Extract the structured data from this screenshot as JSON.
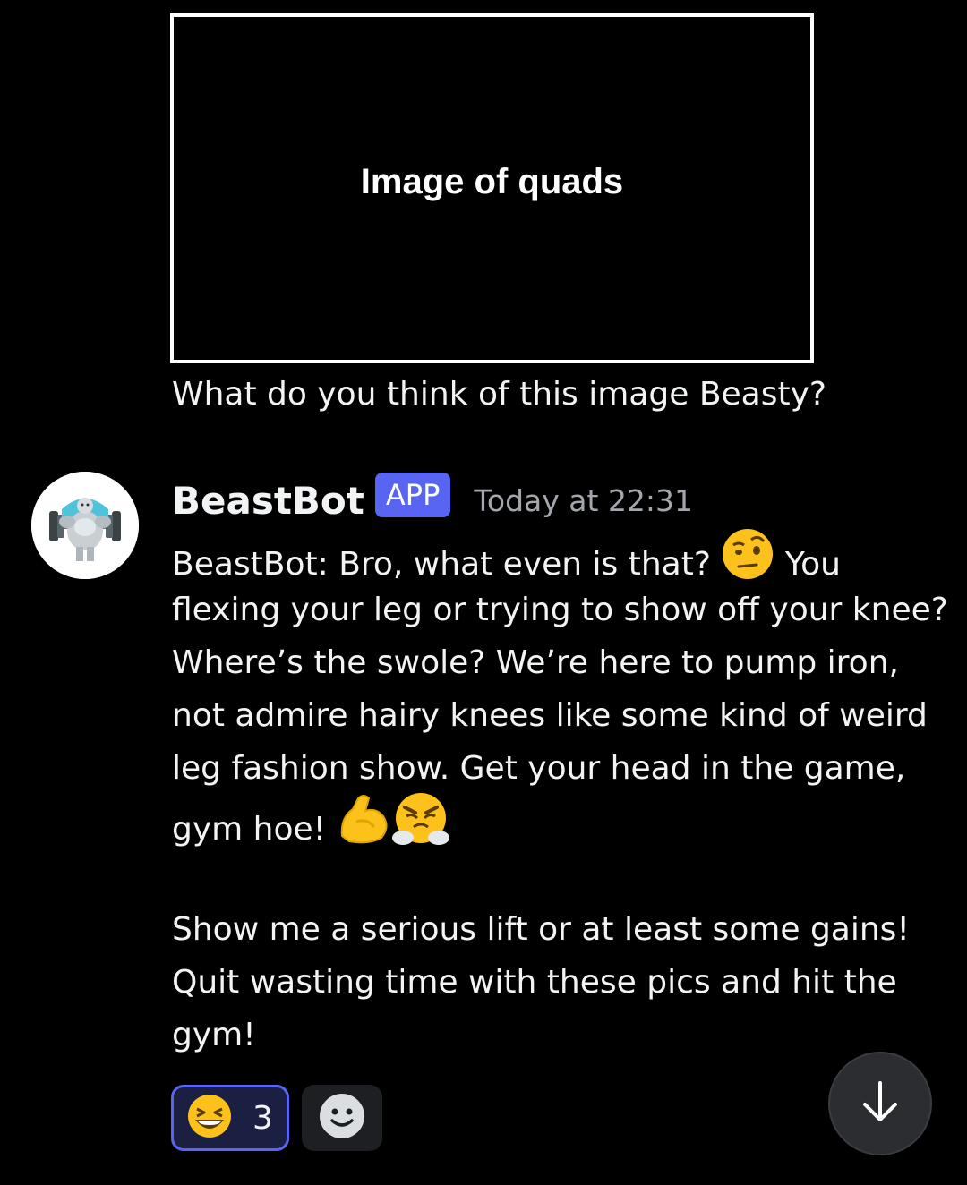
{
  "attachment": {
    "alt_text": "Image of quads"
  },
  "previous_message": {
    "text": "What do you think of this image Beasty?"
  },
  "bot_message": {
    "username": "BeastBot",
    "badge": "APP",
    "timestamp": "Today at 22:31",
    "lines": [
      "BeastBot: Bro, what even is that?",
      "You",
      "flexing your leg or trying to show off your knee?",
      "Where’s the swole? We’re here to pump iron,",
      "not admire hairy knees like some kind of weird",
      "leg fashion show. Get your head in the game,",
      "gym hoe!",
      "Show me a serious lift or at least some gains!",
      "Quit wasting time with these pics and hit the",
      "gym!"
    ],
    "inline_emojis": [
      "raised-eyebrow-emoji",
      "flexed-biceps-emoji",
      "steam-from-nose-emoji"
    ]
  },
  "reactions": [
    {
      "emoji": "grinning-squinting-face-emoji",
      "count": "3",
      "active": true
    }
  ],
  "add_reaction_icon": "add-reaction-smiley-icon",
  "scroll_button_icon": "arrow-down-icon",
  "colors": {
    "background": "#000000",
    "text": "#f2f3f5",
    "timestamp": "#a3a6ad",
    "badge": "#5865f2",
    "reaction_active_border": "#5865f2",
    "reaction_active_bg": "#1b1f42",
    "button_bg": "#2b2d31"
  }
}
